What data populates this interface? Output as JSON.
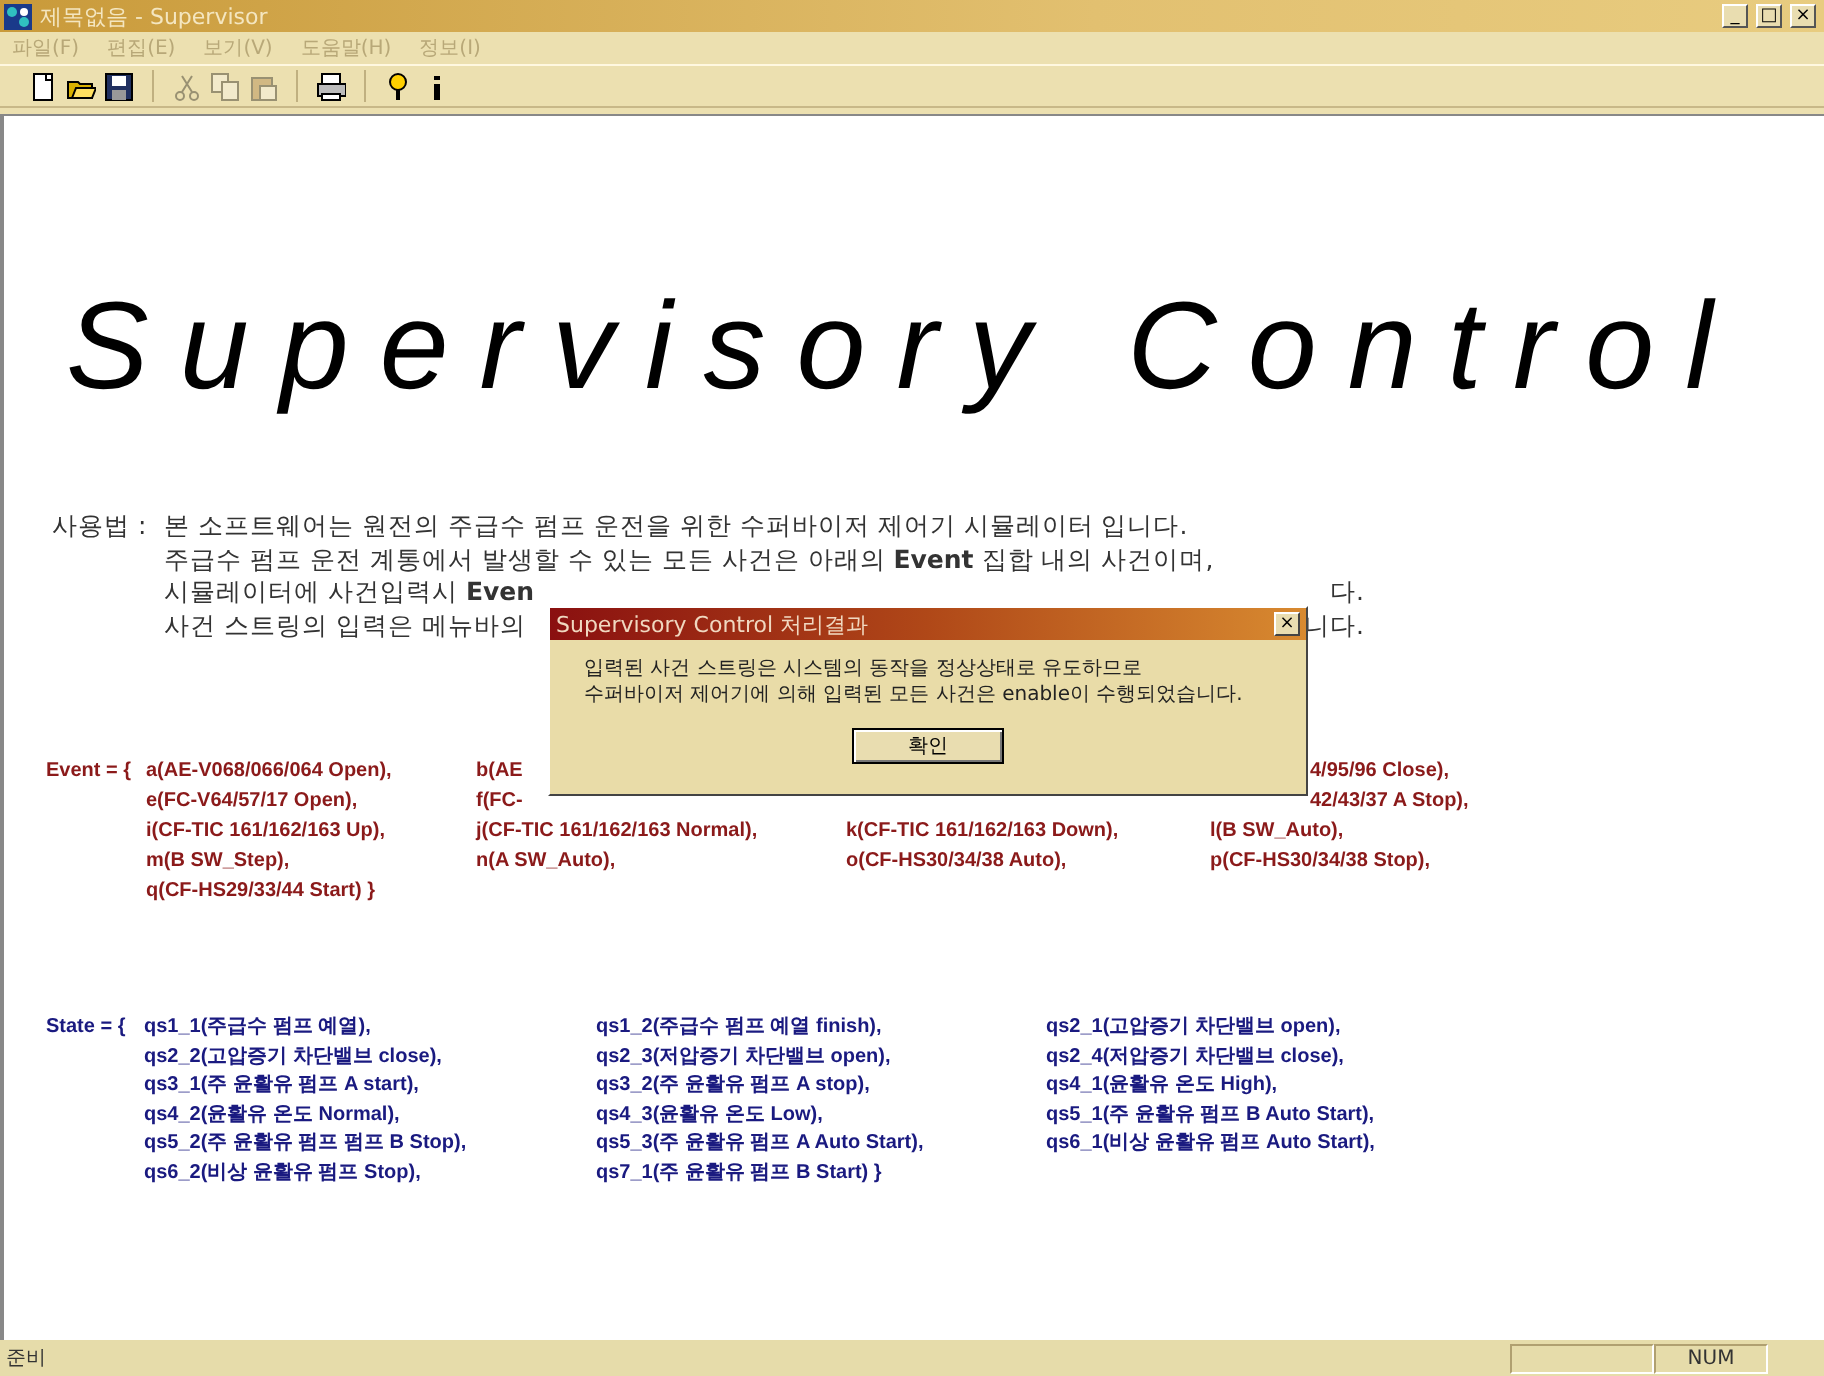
{
  "window": {
    "title": "제목없음 - Supervisor",
    "controls": [
      "_",
      "□",
      "×"
    ]
  },
  "menu": [
    "파일(F)",
    "편집(E)",
    "보기(V)",
    "도움말(H)",
    "정보(I)"
  ],
  "toolbar": [
    {
      "kind": "new",
      "disabled": false
    },
    {
      "kind": "open",
      "disabled": false
    },
    {
      "kind": "save",
      "disabled": false
    },
    {
      "kind": "cut",
      "disabled": true
    },
    {
      "kind": "copy",
      "disabled": true
    },
    {
      "kind": "paste",
      "disabled": true
    },
    {
      "kind": "print",
      "disabled": false
    },
    {
      "kind": "help",
      "disabled": false
    },
    {
      "kind": "info",
      "disabled": false
    }
  ],
  "heading": "Supervisory Control",
  "usage": {
    "label": "사용법 :",
    "lines": [
      {
        "left": "본 소프트웨어는 원전의 주급수 펌프 운전을 위한 수퍼바이저 제어기 시뮬레이터 입니다."
      },
      {
        "left": "주급수 펌프 운전 계통에서 발생할 수 있는 모든 사건은 아래의 **Event** 집합 내의 사건이며,"
      },
      {
        "left": "시뮬레이터에 사건입력시 **Even**",
        "right": "다."
      },
      {
        "left": "사건 스트링의 입력은 메뉴바의",
        "right": "니다."
      }
    ]
  },
  "events": {
    "prefix": "Event = {",
    "rows": [
      [
        {
          "text": "a(AE-V068/066/064 Open),"
        },
        {
          "text": "b(AE"
        },
        null,
        {
          "text": "4/95/96 Close),",
          "kind": "tail"
        }
      ],
      [
        {
          "text": "e(FC-V64/57/17 Open),"
        },
        {
          "text": "f(FC-"
        },
        null,
        {
          "text": "42/43/37 A Stop),",
          "kind": "tail"
        }
      ],
      [
        {
          "text": "i(CF-TIC 161/162/163 Up),"
        },
        {
          "text": "j(CF-TIC 161/162/163 Normal),"
        },
        {
          "text": "k(CF-TIC 161/162/163 Down),"
        },
        {
          "text": "l(B SW_Auto),"
        }
      ],
      [
        {
          "text": "m(B SW_Step),"
        },
        {
          "text": "n(A SW_Auto),"
        },
        {
          "text": "o(CF-HS30/34/38 Auto),"
        },
        {
          "text": "p(CF-HS30/34/38 Stop),"
        }
      ],
      [
        {
          "text": "q(CF-HS29/33/44 Start) }"
        },
        null,
        null,
        null
      ]
    ]
  },
  "states": {
    "prefix": "State = {",
    "rows": [
      [
        "qs1_1(주급수 펌프 예열),",
        "qs1_2(주급수 펌프 예열 finish),",
        "qs2_1(고압증기 차단밸브 open),"
      ],
      [
        "qs2_2(고압증기 차단밸브 close),",
        "qs2_3(저압증기 차단밸브 open),",
        "qs2_4(저압증기 차단밸브 close),"
      ],
      [
        "qs3_1(주 윤활유 펌프 A start),",
        "qs3_2(주 윤활유 펌프 A stop),",
        "qs4_1(윤활유 온도 High),"
      ],
      [
        "qs4_2(윤활유 온도 Normal),",
        "qs4_3(윤활유 온도 Low),",
        "qs5_1(주 윤활유 펌프 B Auto Start),"
      ],
      [
        "qs5_2(주 윤활유 펌프 펌프 B Stop),",
        "qs5_3(주 윤활유 펌프 A Auto Start),",
        "qs6_1(비상 윤활유 펌프 Auto Start),"
      ],
      [
        "qs6_2(비상 윤활유 펌프 Stop),",
        "qs7_1(주 윤활유 펌프 B Start) }"
      ]
    ]
  },
  "dialog": {
    "title": "Supervisory Control 처리결과",
    "close": "×",
    "lines": [
      "입력된 사건 스트링은 시스템의 동작을 정상상태로 유도하므로",
      "수퍼바이저 제어기에 의해 입력된 모든 사건은 enable이 수행되었습니다."
    ],
    "button": "확인"
  },
  "status_bar": {
    "message": "준비",
    "indicator": "NUM"
  }
}
